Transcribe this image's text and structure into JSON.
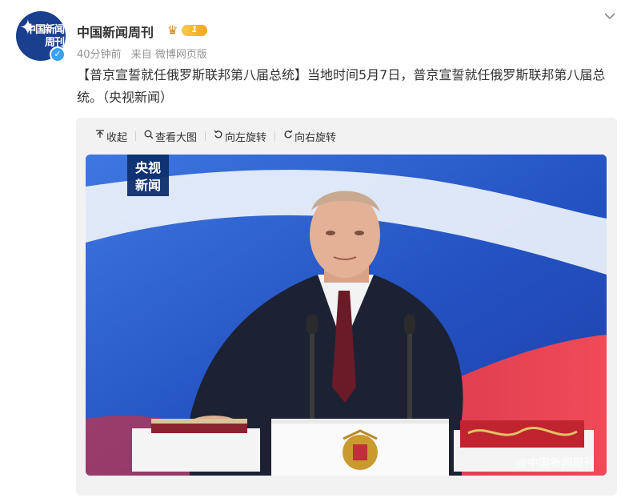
{
  "post": {
    "author": "中国新闻周刊",
    "avatar_text": "中国新闻周刊",
    "verified_icon": "check-icon",
    "badge_level": "1",
    "time": "40分钟前",
    "source": "来自 微博网页版",
    "text": "【普京宣誓就任俄罗斯联邦第八届总统】当地时间5月7日，普京宣誓就任俄罗斯联邦第八届总统。（央视新闻）"
  },
  "toolbar": {
    "collapse": "收起",
    "view_large": "查看大图",
    "rotate_left": "向左旋转",
    "rotate_right": "向右旋转"
  },
  "image": {
    "logo_line1": "央视",
    "logo_line2": "新闻",
    "watermark": "@中国新闻周刊"
  },
  "colors": {
    "accent": "#3aa0ef",
    "badge": "#f3a521",
    "avatar_bg": "#1b3f8f"
  }
}
